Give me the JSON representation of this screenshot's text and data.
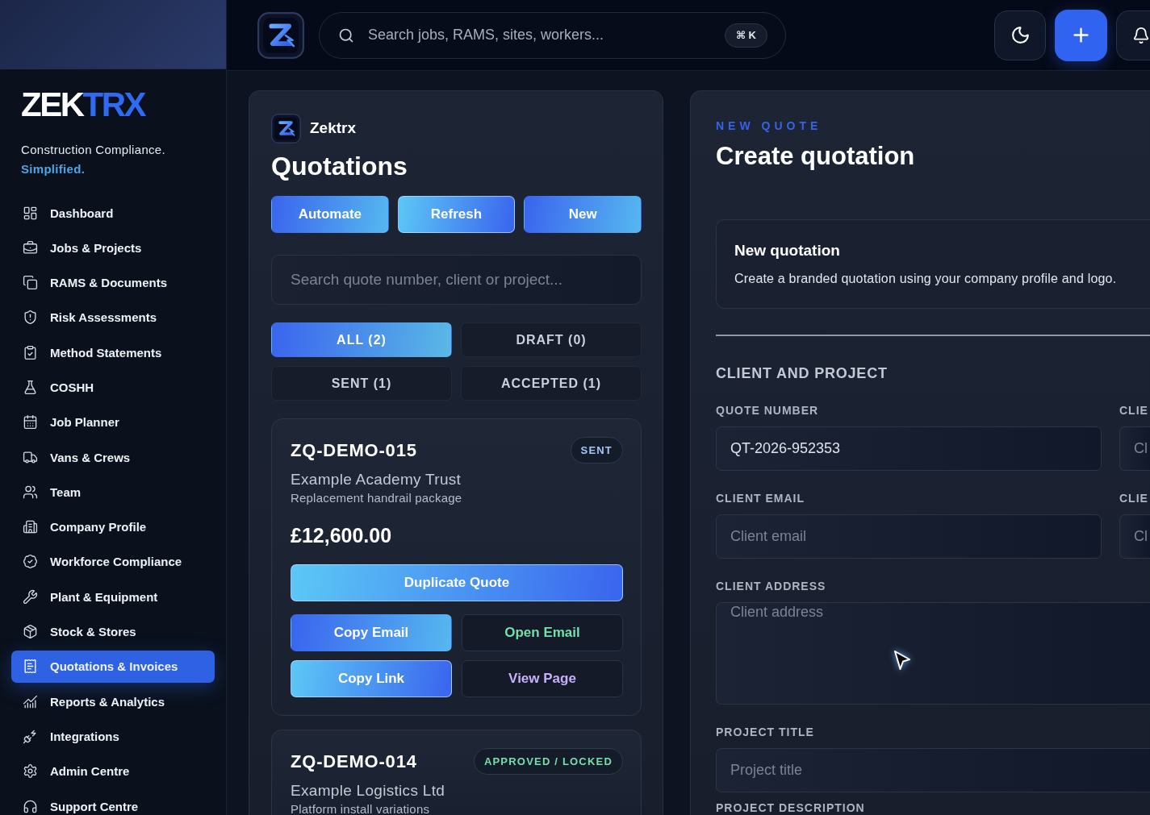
{
  "sidebar": {
    "logo": {
      "text": "ZEK",
      "accent": "TRX"
    },
    "tagline": "Construction Compliance.",
    "tagline_accent": "Simplified.",
    "items": [
      {
        "label": "Dashboard",
        "selected": false
      },
      {
        "label": "Jobs & Projects",
        "selected": false
      },
      {
        "label": "RAMS & Documents",
        "selected": false
      },
      {
        "label": "Risk Assessments",
        "selected": false
      },
      {
        "label": "Method Statements",
        "selected": false
      },
      {
        "label": "COSHH",
        "selected": false
      },
      {
        "label": "Job Planner",
        "selected": false
      },
      {
        "label": "Vans & Crews",
        "selected": false
      },
      {
        "label": "Team",
        "selected": false
      },
      {
        "label": "Company Profile",
        "selected": false
      },
      {
        "label": "Workforce Compliance",
        "selected": false
      },
      {
        "label": "Plant & Equipment",
        "selected": false
      },
      {
        "label": "Stock & Stores",
        "selected": false
      },
      {
        "label": "Quotations & Invoices",
        "selected": true
      },
      {
        "label": "Reports & Analytics",
        "selected": false
      },
      {
        "label": "Integrations",
        "selected": false
      },
      {
        "label": "Admin Centre",
        "selected": false
      },
      {
        "label": "Support Centre",
        "selected": false
      }
    ]
  },
  "topbar": {
    "search": {
      "placeholder": "Search jobs, RAMS, sites, workers...",
      "shortcut": "⌘ K"
    }
  },
  "quotations_panel": {
    "brand": "Zektrx",
    "title": "Quotations",
    "actions": [
      {
        "label": "Automate",
        "kind": "gradient"
      },
      {
        "label": "Refresh",
        "kind": "gradient-reverse"
      },
      {
        "label": "New",
        "kind": "gradient"
      }
    ],
    "search": {
      "placeholder": "Search quote number, client or project..."
    },
    "filters": [
      {
        "label": "ALL (2)",
        "selected": true
      },
      {
        "label": "DRAFT (0)",
        "selected": false
      },
      {
        "label": "SENT (1)",
        "selected": false
      },
      {
        "label": "ACCEPTED (1)",
        "selected": false
      }
    ],
    "quotes": [
      {
        "number": "ZQ-DEMO-015",
        "status": {
          "label": "SENT",
          "color": "#a3c8f5"
        },
        "client": "Example Academy Trust",
        "project": "Replacement handrail package",
        "amount": "£12,600.00",
        "primary_action": {
          "label": "Duplicate Quote",
          "kind": "gradient-reverse"
        },
        "actions": [
          {
            "label": "Copy Email",
            "kind": "gradient"
          },
          {
            "label": "Open Email",
            "kind": "outline",
            "color": "#74e0a8"
          },
          {
            "label": "Copy Link",
            "kind": "gradient-reverse"
          },
          {
            "label": "View Page",
            "kind": "outline",
            "color": "#c9b0fb"
          }
        ]
      },
      {
        "number": "ZQ-DEMO-014",
        "status": {
          "label": "APPROVED / LOCKED",
          "color": "#74e0a8"
        },
        "client": "Example Logistics Ltd",
        "project": "Platform install variations"
      }
    ]
  },
  "form_panel": {
    "eyebrow": "NEW QUOTE",
    "title": "Create quotation",
    "notice": {
      "title": "New quotation",
      "text": "Create a branded quotation using your company profile and logo."
    },
    "section": "CLIENT AND PROJECT",
    "fields": [
      {
        "label": "QUOTE NUMBER",
        "value": "QT-2026-952353",
        "kind": "input"
      },
      {
        "label": "CLIE",
        "placeholder": "Cl",
        "kind": "input"
      },
      {
        "label": "CLIENT EMAIL",
        "placeholder": "Client email",
        "kind": "input"
      },
      {
        "label": "CLIE",
        "placeholder": "Cl",
        "kind": "input"
      },
      {
        "label": "CLIENT ADDRESS",
        "placeholder": "Client address",
        "kind": "textarea"
      },
      {
        "label": "PROJECT TITLE",
        "placeholder": "Project title",
        "kind": "input-wide"
      },
      {
        "label": "PROJECT DESCRIPTION",
        "kind": "label"
      }
    ]
  }
}
